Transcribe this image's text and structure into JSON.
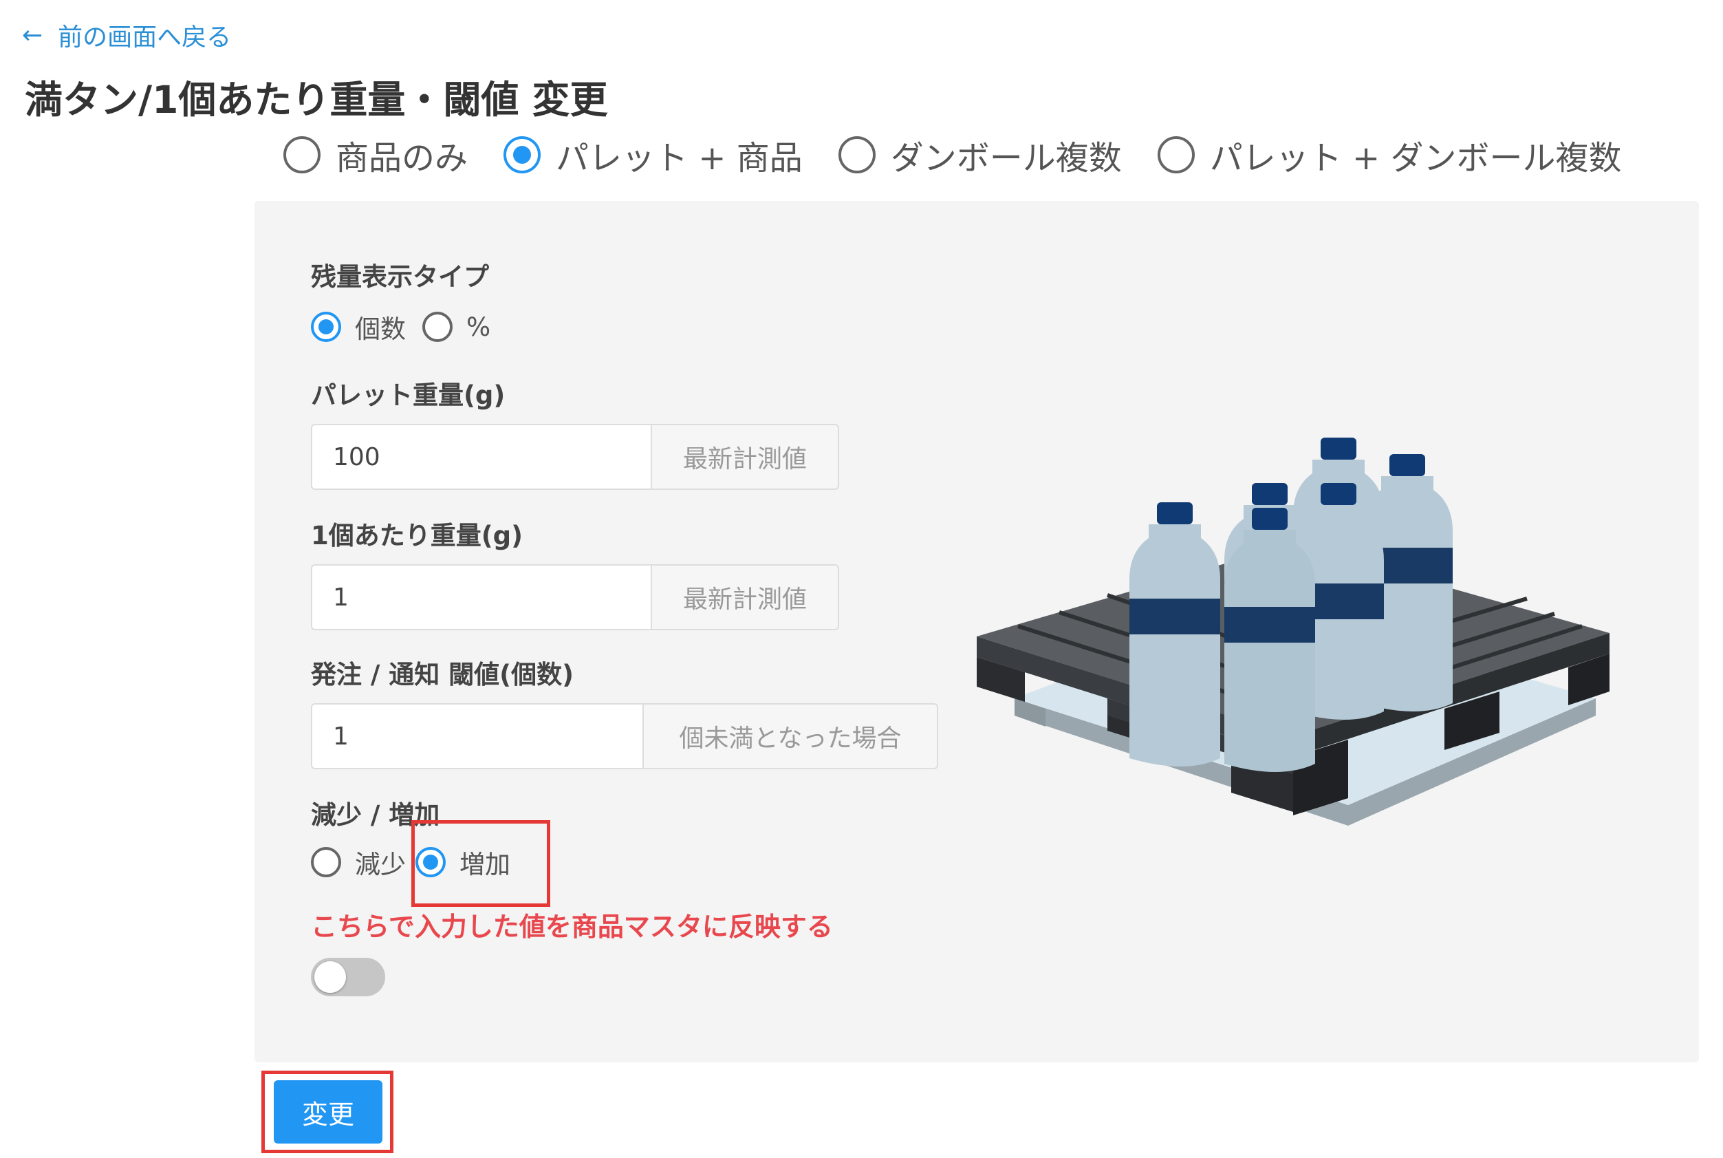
{
  "nav": {
    "back_label": "前の画面へ戻る",
    "back_icon": "arrow-left-icon"
  },
  "page": {
    "title": "満タン/1個あたり重量・閾値 変更"
  },
  "mode_options": [
    {
      "label": "商品のみ",
      "selected": false
    },
    {
      "label": "パレット + 商品",
      "selected": true
    },
    {
      "label": "ダンボール複数",
      "selected": false
    },
    {
      "label": "パレット + ダンボール複数",
      "selected": false
    }
  ],
  "form": {
    "display_type": {
      "label": "残量表示タイプ",
      "options": [
        {
          "label": "個数",
          "selected": true
        },
        {
          "label": "%",
          "selected": false
        }
      ]
    },
    "pallet_weight": {
      "label": "パレット重量(g)",
      "value": "100",
      "addon": "最新計測値"
    },
    "unit_weight": {
      "label": "1個あたり重量(g)",
      "value": "1",
      "addon": "最新計測値"
    },
    "threshold": {
      "label": "発注 / 通知 閾値(個数)",
      "value": "1",
      "addon": "個未満となった場合"
    },
    "direction": {
      "label": "減少 / 増加",
      "options": [
        {
          "label": "減少",
          "selected": false
        },
        {
          "label": "増加",
          "selected": true
        }
      ]
    },
    "reflect_notice": "こちらで入力した値を商品マスタに反映する",
    "reflect_toggle_on": false,
    "submit_label": "変更"
  },
  "illustration": {
    "icon": "pallet-with-bottles-illustration"
  },
  "colors": {
    "accent": "#2196f3",
    "link": "#2b8fd6",
    "warning": "#e8484d",
    "highlight": "#e53935",
    "panel": "#f4f4f4"
  }
}
